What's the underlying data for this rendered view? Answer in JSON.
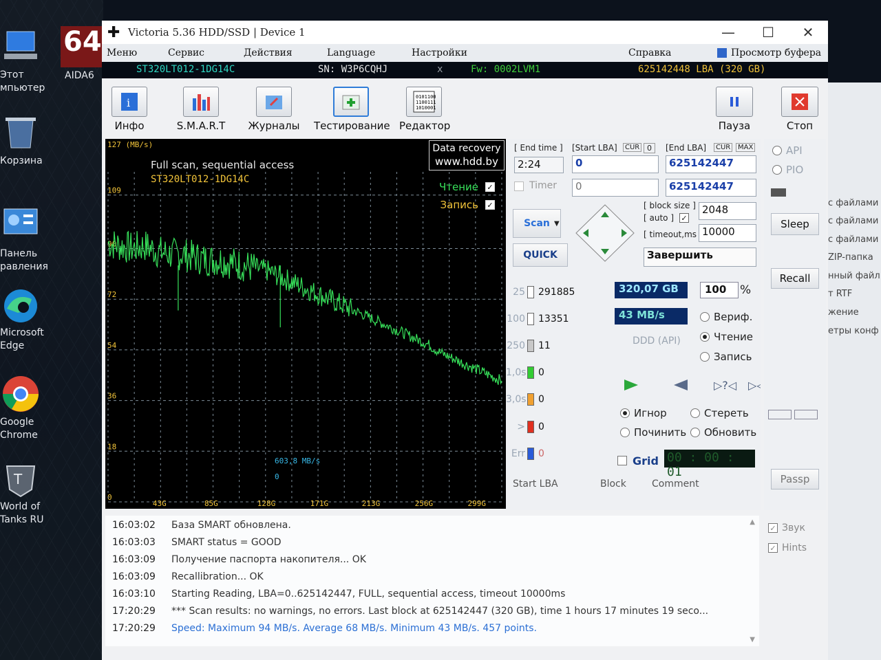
{
  "desktop": {
    "icons": [
      {
        "label": "Этот\nмпьютер"
      },
      {
        "label": "Корзина"
      },
      {
        "label": "Панель\nравления"
      },
      {
        "label": "Microsoft\nEdge"
      },
      {
        "label": "Google\nChrome"
      },
      {
        "label": "World of\nTanks RU"
      }
    ],
    "aida": {
      "big": "64",
      "label": "AIDA6"
    }
  },
  "window": {
    "title": "Victoria 5.36 HDD/SSD | Device 1",
    "controls": {
      "minimize": "—",
      "maximize": "☐",
      "close": "✕"
    }
  },
  "menu": {
    "items": [
      "Меню",
      "Сервис",
      "Действия",
      "Language",
      "Настройки",
      "Справка"
    ],
    "buffer": "Просмотр буфера"
  },
  "device": {
    "model": "ST320LT012-1DG14C",
    "serial": "SN: W3P6CQHJ",
    "x": "x",
    "firmware": "Fw: 0002LVM1",
    "lba": "625142448 LBA (320 GB)"
  },
  "toolbar": {
    "info": "Инфо",
    "smart": "S.M.A.R.T",
    "journals": "Журналы",
    "testing": "Тестирование",
    "editor": "Редактор",
    "pause": "Пауза",
    "stop": "Стоп"
  },
  "graph": {
    "unit": "127 (MB/s)",
    "title": "Full scan, sequential access",
    "model": "ST320LT012-1DG14C",
    "brand1": "Data recovery",
    "brand2": "www.hdd.by",
    "read_label": "Чтение",
    "write_label": "Запись",
    "current_speed": "603,8 MB/s",
    "current_zero": "0",
    "colors": {
      "read": "#37e05a",
      "grid": "#7d8d99",
      "axis_text": "#f2c43a"
    }
  },
  "chart_data": {
    "type": "line",
    "title": "Full scan, sequential access",
    "xlabel": "",
    "ylabel": "127 (MB/s)",
    "ylim": [
      0,
      127
    ],
    "yticks": [
      "109",
      "90",
      "72",
      "54",
      "36",
      "18",
      "0"
    ],
    "xticks": [
      "43G",
      "85G",
      "128G",
      "171G",
      "213G",
      "256G",
      "299G"
    ],
    "grid": true,
    "series": [
      {
        "name": "Чтение",
        "x": [
          0,
          10,
          20,
          30,
          40,
          50,
          60,
          70,
          80,
          90,
          100,
          110,
          120,
          130,
          140,
          150,
          160,
          170,
          180,
          190,
          200,
          210,
          220,
          230,
          240,
          250,
          260,
          270,
          280,
          290,
          300,
          310,
          320
        ],
        "y": [
          92,
          91,
          90,
          91,
          89,
          88,
          88,
          87,
          86,
          86,
          85,
          84,
          83,
          82,
          80,
          78,
          76,
          74,
          72,
          70,
          68,
          66,
          64,
          62,
          60,
          58,
          56,
          53,
          51,
          49,
          47,
          45,
          43
        ]
      }
    ]
  },
  "scan": {
    "end_time_label": "[ End time ]",
    "start_lba_label": "[Start LBA]",
    "cur": "CUR",
    "zero_btn": "0",
    "end_lba_label": "[End LBA]",
    "max": "MAX",
    "end_time": "2:24",
    "start_lba": "0",
    "end_lba": "625142447",
    "timer_label": "Timer",
    "timer_value": "0",
    "end_lba2": "625142447",
    "block_size_label": "[ block size ]",
    "auto_label": "[ auto ]",
    "block_size": "2048",
    "timeout_label": "[ timeout,ms ]",
    "timeout": "10000",
    "scan_btn": "Scan",
    "quick_btn": "QUICK",
    "finish": "Завершить"
  },
  "mode": {
    "api": "API",
    "pio": "PIO",
    "sleep": "Sleep",
    "recall": "Recall",
    "passp": "Passp"
  },
  "counters": [
    {
      "label": "25",
      "value": "291885",
      "color": "#ffffff"
    },
    {
      "label": "100",
      "value": "13351",
      "color": "#ffffff"
    },
    {
      "label": "250",
      "value": "11",
      "color": "#c8c8c8"
    },
    {
      "label": "1,0s",
      "value": "0",
      "color": "#33cc33"
    },
    {
      "label": "3,0s",
      "value": "0",
      "color": "#f0a030"
    },
    {
      "label": ">",
      "value": "0",
      "color": "#e03020"
    },
    {
      "label": "Err",
      "value": "0",
      "color": "#2a5bd8"
    }
  ],
  "stats": {
    "size": "320,07 GB",
    "percent": "100",
    "percent_sign": "%",
    "speed": "43 MB/s",
    "ddd": "DDD (API)",
    "verify": "Вериф.",
    "read": "Чтение",
    "write": "Запись",
    "ignore": "Игнор",
    "erase": "Стереть",
    "repair": "Починить",
    "refresh": "Обновить",
    "grid": "Grid",
    "timer": "00 : 00 : 01"
  },
  "table_headers": [
    "Start LBA",
    "Block",
    "Comment"
  ],
  "log": [
    {
      "time": "16:03:02",
      "text": "База SMART обновлена.",
      "blue": false
    },
    {
      "time": "16:03:03",
      "text": "SMART status = GOOD",
      "blue": false
    },
    {
      "time": "16:03:09",
      "text": "Получение паспорта накопителя... OK",
      "blue": false
    },
    {
      "time": "16:03:09",
      "text": "Recallibration... OK",
      "blue": false
    },
    {
      "time": "16:03:10",
      "text": "Starting Reading, LBA=0..625142447, FULL, sequential access, timeout 10000ms",
      "blue": false
    },
    {
      "time": "17:20:29",
      "text": "*** Scan results: no warnings, no errors. Last block at 625142447 (320 GB), time 1 hours 17 minutes 19 seco...",
      "blue": false
    },
    {
      "time": "17:20:29",
      "text": "Speed: Maximum 94 MB/s. Average 68 MB/s. Minimum 43 MB/s. 457 points.",
      "blue": true
    }
  ],
  "options": {
    "sound": "Звук",
    "hints": "Hints"
  },
  "background_window": {
    "items": [
      "с файлами",
      "с файлами",
      "с файлами",
      "ZIP-папка",
      "нный файл",
      "т RTF",
      "жение",
      "етры конф"
    ]
  }
}
